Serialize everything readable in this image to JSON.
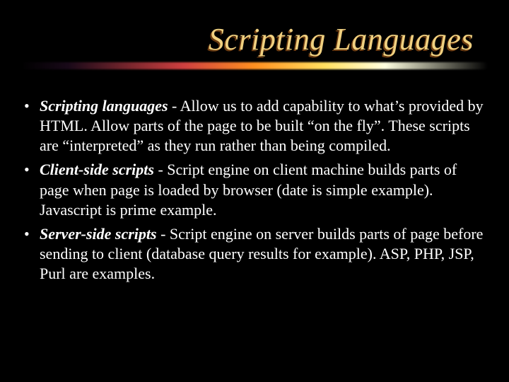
{
  "title": "Scripting Languages",
  "bullets": [
    {
      "term": "Scripting languages",
      "rest": " - Allow us to add capability to what’s provided by HTML. Allow parts of the page to be built “on the fly”. These scripts are “interpreted” as they run rather than being compiled."
    },
    {
      "term": "Client-side scripts",
      "rest": " - Script engine on client machine builds parts of page when page is loaded by browser (date is simple example). Javascript is prime example."
    },
    {
      "term": "Server-side scripts",
      "rest": " - Script engine on server builds parts of page before sending to client (database query results for example). ASP, PHP, JSP, Purl are examples."
    }
  ]
}
